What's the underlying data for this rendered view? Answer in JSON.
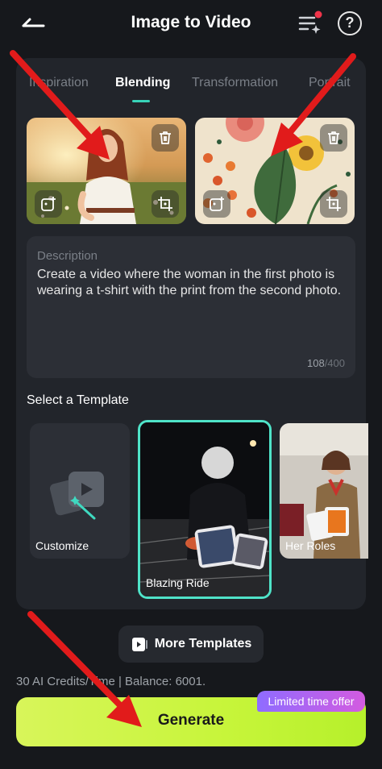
{
  "header": {
    "title": "Image to Video",
    "back_icon": "arrow-left-icon",
    "list_icon": "sparkle-list-icon",
    "help_icon": "help-circle-icon",
    "help_glyph": "?"
  },
  "tabs": [
    {
      "label": "Inspiration",
      "active": false
    },
    {
      "label": "Blending",
      "active": true
    },
    {
      "label": "Transformation",
      "active": false
    },
    {
      "label": "Portrait",
      "active": false
    }
  ],
  "images": [
    {
      "name": "first-photo",
      "depicts": "woman in a field at sunset",
      "icons": [
        "trash-icon",
        "add-image-icon",
        "crop-icon"
      ]
    },
    {
      "name": "second-photo",
      "depicts": "botanical flower print",
      "icons": [
        "trash-icon",
        "add-image-icon",
        "crop-icon"
      ]
    }
  ],
  "description": {
    "label": "Description",
    "text": "Create a video where the woman in the first photo is wearing a t-shirt with the print from the second photo.",
    "count": "108",
    "max": "/400"
  },
  "templates": {
    "section_title": "Select a Template",
    "items": [
      {
        "label": "Customize",
        "selected": false
      },
      {
        "label": "Blazing Ride",
        "selected": true
      },
      {
        "label": "Her Roles",
        "selected": false
      }
    ]
  },
  "more_templates": {
    "label": "More Templates",
    "icon": "video-template-icon"
  },
  "credits": "30 AI Credits/Time | Balance: 6001.",
  "generate": {
    "label": "Generate",
    "badge": "Limited time offer"
  },
  "colors": {
    "accent": "#38d3b8",
    "generate": "#c7f53a",
    "badge_start": "#8f6cff",
    "badge_end": "#d35be0",
    "arrow": "#e11b1b",
    "background": "#16181c",
    "panel": "#22252b"
  }
}
